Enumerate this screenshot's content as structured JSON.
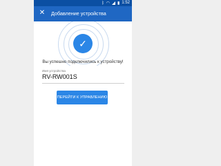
{
  "status_bar": {
    "time": "1:52"
  },
  "app_bar": {
    "title": "Добавление устройства",
    "close_label": "✕"
  },
  "success": {
    "message": "Вы успешно подключились к устройству!"
  },
  "device_name": {
    "label": "Имя устройства",
    "value": "RV-RW001S"
  },
  "actions": {
    "primary_label": "ПЕРЕЙТИ К УПРАВЛЕНИЮ"
  },
  "colors": {
    "primary": "#2b86e6",
    "status_bar": "#0b4fa3",
    "app_bar": "#1f67c3"
  },
  "icons": {
    "close": "close-icon",
    "success": "check-icon"
  }
}
